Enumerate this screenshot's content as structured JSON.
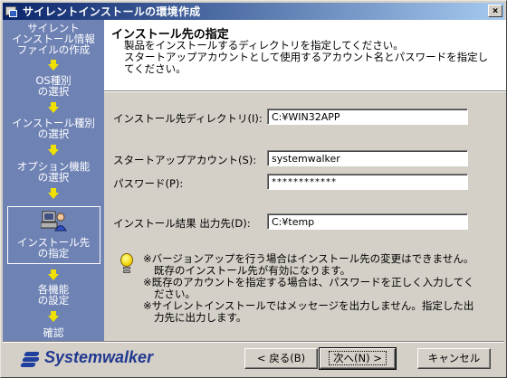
{
  "window": {
    "title": "サイレントインストールの環境作成",
    "close_label": "×"
  },
  "sidebar": {
    "steps": [
      {
        "label": "サイレント\nインストール情報\nファイルの作成"
      },
      {
        "label": "OS種別\nの選択"
      },
      {
        "label": "インストール種別\nの選択"
      },
      {
        "label": "オプション機能\nの選択"
      },
      {
        "label": "インストール先\nの指定"
      },
      {
        "label": "各機能\nの設定"
      },
      {
        "label": "確認"
      }
    ],
    "current_step_icon": "computer-user-icon"
  },
  "header": {
    "title": "インストール先の指定",
    "description": "製品をインストールするディレクトリを指定してください。\nスタートアップアカウントとして使用するアカウント名とパスワードを指定してください。"
  },
  "form": {
    "install_dir_label": "インストール先ディレクトリ(I):",
    "install_dir_value": "C:¥WIN32APP",
    "account_label": "スタートアップアカウント(S):",
    "account_value": "systemwalker",
    "password_label": "パスワード(P):",
    "password_value": "************",
    "result_dir_label": "インストール結果 出力先(D):",
    "result_dir_value": "C:¥temp"
  },
  "notes": {
    "icon": "lightbulb-icon",
    "lines": [
      "※バージョンアップを行う場合はインストール先の変更はできません。既存のインストール先が有効になります。",
      "※既存のアカウントを指定する場合は、パスワードを正しく入力してください。",
      "※サイレントインストールではメッセージを出力しません。指定した出力先に出力します。"
    ]
  },
  "footer": {
    "logo_text": "Systemwalker",
    "back_label": "< 戻る(B)",
    "next_label": "次へ(N) >",
    "cancel_label": "キャンセル"
  }
}
